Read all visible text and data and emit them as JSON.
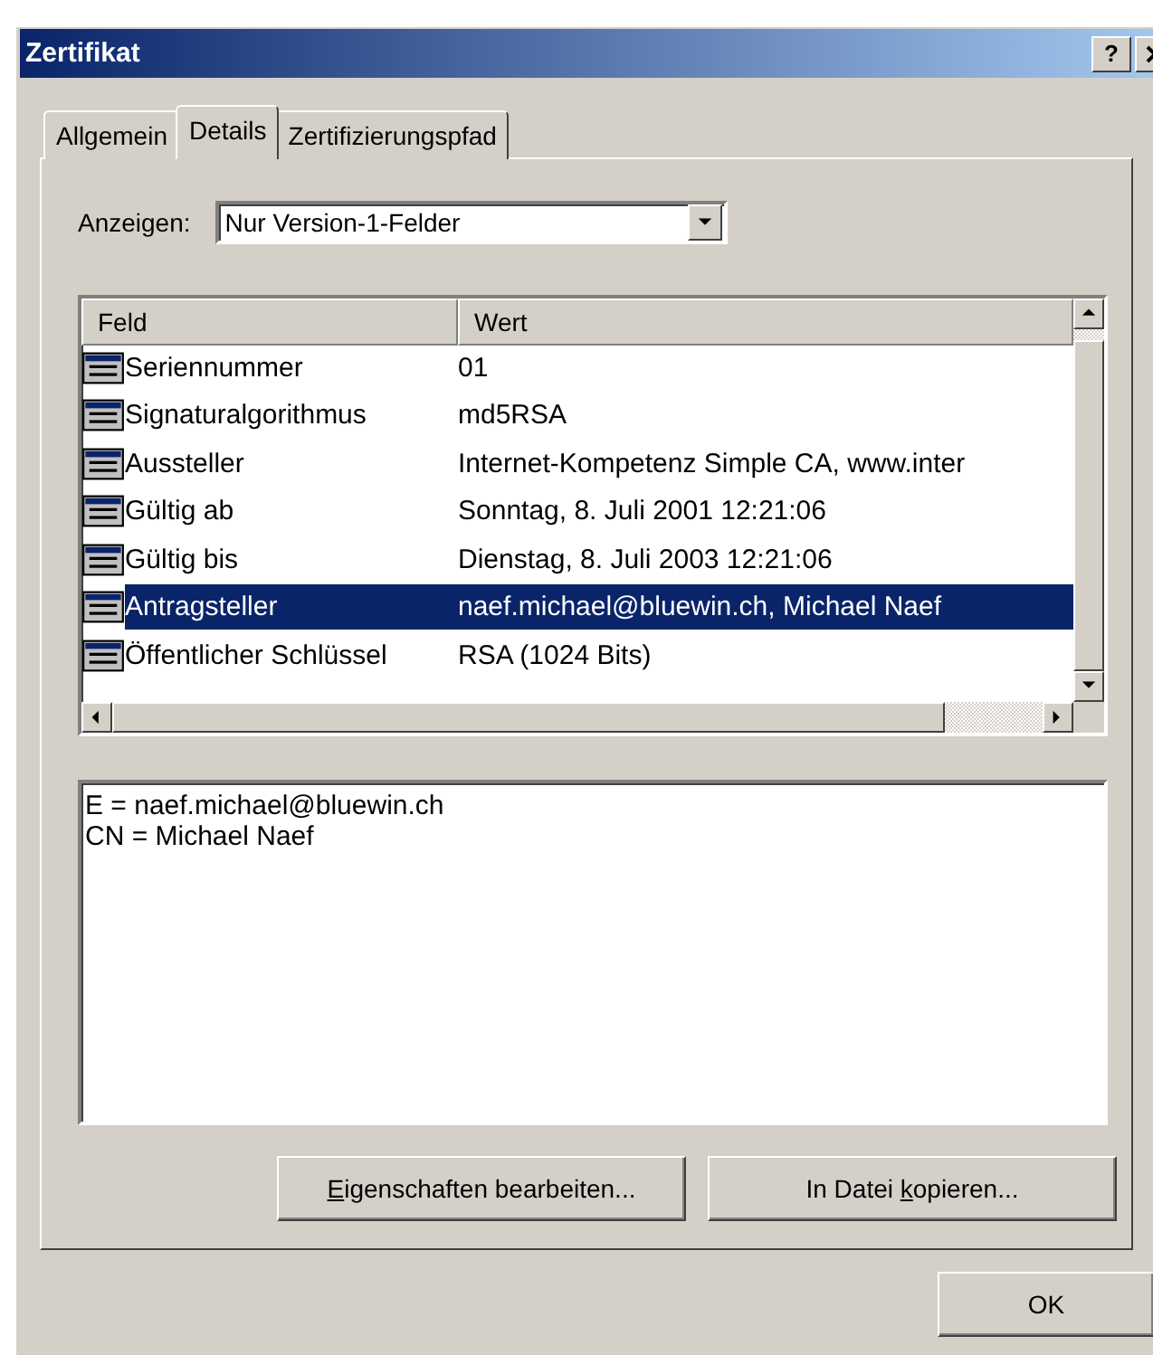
{
  "window": {
    "title": "Zertifikat",
    "help": "?"
  },
  "tabs": [
    {
      "label": "Allgemein",
      "selected": false
    },
    {
      "label": "Details",
      "selected": true
    },
    {
      "label": "Zertifizierungspfad",
      "selected": false
    }
  ],
  "show": {
    "label": "Anzeigen:",
    "value": "Nur Version-1-Felder"
  },
  "table": {
    "columns": [
      "Feld",
      "Wert"
    ],
    "rows": [
      {
        "field": "Seriennummer",
        "value": "01",
        "selected": false
      },
      {
        "field": "Signaturalgorithmus",
        "value": "md5RSA",
        "selected": false
      },
      {
        "field": "Aussteller",
        "value": "Internet-Kompetenz Simple CA, www.inter",
        "selected": false
      },
      {
        "field": "Gültig ab",
        "value": "Sonntag, 8. Juli 2001 12:21:06",
        "selected": false
      },
      {
        "field": "Gültig bis",
        "value": "Dienstag, 8. Juli 2003 12:21:06",
        "selected": false
      },
      {
        "field": "Antragsteller",
        "value": "naef.michael@bluewin.ch, Michael Naef",
        "selected": true
      },
      {
        "field": "Öffentlicher Schlüssel",
        "value": "RSA (1024 Bits)",
        "selected": false
      }
    ]
  },
  "details": [
    "E = naef.michael@bluewin.ch",
    "CN = Michael Naef"
  ],
  "buttons": [
    {
      "key": "E",
      "after": "igenschaften bearbeiten..."
    },
    {
      "before": "In Datei ",
      "key": "k",
      "after": "opieren..."
    }
  ],
  "ok": "OK"
}
